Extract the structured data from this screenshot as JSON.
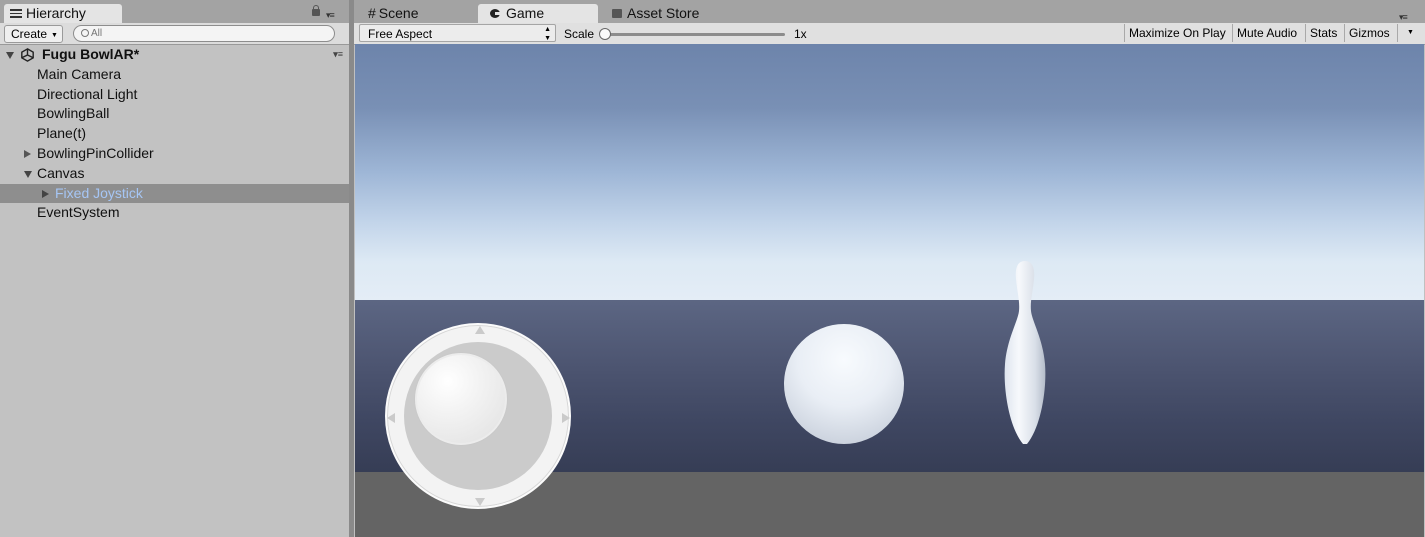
{
  "hierarchy": {
    "tab_label": "Hierarchy",
    "create_label": "Create",
    "search_placeholder": "All",
    "scene_name": "Fugu BowlAR*",
    "items": [
      {
        "label": "Main Camera"
      },
      {
        "label": "Directional Light"
      },
      {
        "label": "BowlingBall"
      },
      {
        "label": "Plane(t)"
      },
      {
        "label": "BowlingPinCollider",
        "expandable": true,
        "expanded": false
      },
      {
        "label": "Canvas",
        "expandable": true,
        "expanded": true
      },
      {
        "label": "Fixed Joystick",
        "expandable": true,
        "expanded": false,
        "selected": true,
        "indent": 1
      },
      {
        "label": "EventSystem"
      }
    ]
  },
  "tabs": [
    {
      "label": "Scene",
      "icon": "hash-icon",
      "active": false
    },
    {
      "label": "Game",
      "icon": "gamepad-icon",
      "active": true
    },
    {
      "label": "Asset Store",
      "icon": "shopping-bag-icon",
      "active": false
    }
  ],
  "game_toolbar": {
    "aspect": "Free Aspect",
    "scale_label": "Scale",
    "scale_value": "1x",
    "scale_slider_fraction": 0.0,
    "maximize_on_play": "Maximize On Play",
    "mute_audio": "Mute Audio",
    "stats": "Stats",
    "gizmos": "Gizmos"
  },
  "colors": {
    "selection_bg": "#8e8e8e",
    "selection_text": "#a6c6f5",
    "sky_top": "#6d84ab",
    "horizon": "#e4edf6",
    "ground": "#4c5470",
    "floor": "#646464"
  }
}
